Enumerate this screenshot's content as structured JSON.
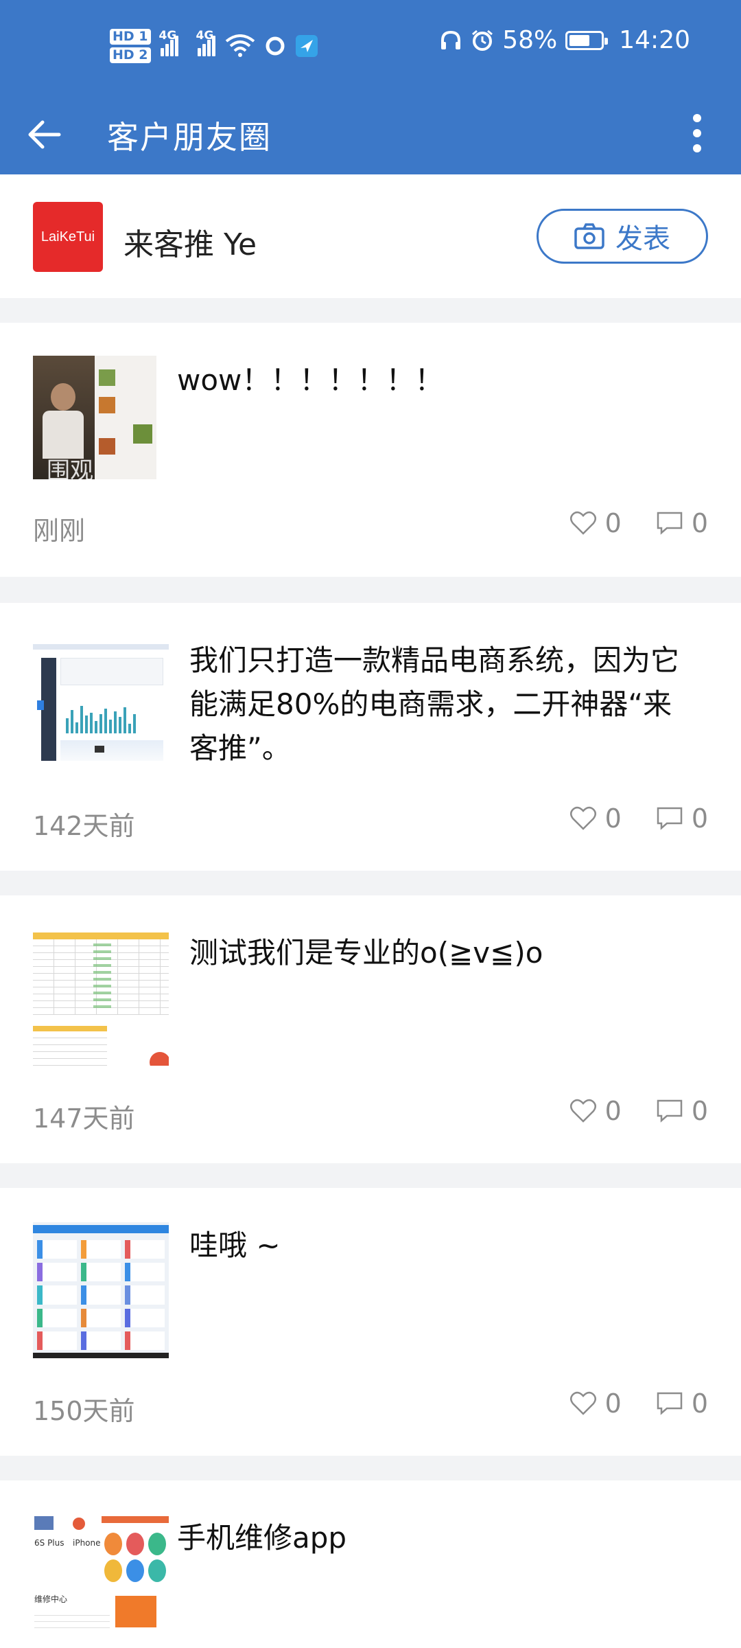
{
  "status": {
    "hd1": "HD 1",
    "hd2": "HD 2",
    "net1": "4G",
    "net2": "4G",
    "battery_percent": "58%",
    "battery_level": 0.58,
    "time": "14:20"
  },
  "appbar": {
    "title": "客户朋友圈"
  },
  "profile": {
    "logo_text": "LaiKeTui",
    "name": "来客推 Ye",
    "post_button": "发表"
  },
  "posts": [
    {
      "text": "wow！！！！！！！",
      "thumb_caption": "围观",
      "time": "刚刚",
      "likes": "0",
      "comments": "0"
    },
    {
      "text": "我们只打造一款精品电商系统，因为它能满足80%的电商需求，二开神器“来客推”。",
      "time": "142天前",
      "likes": "0",
      "comments": "0"
    },
    {
      "text": "测试我们是专业的o(≧v≦)o",
      "time": "147天前",
      "likes": "0",
      "comments": "0"
    },
    {
      "text": "哇哦 ~",
      "time": "150天前",
      "likes": "0",
      "comments": "0"
    },
    {
      "text": "手机维修app",
      "thumb_labels": [
        "6S Plus",
        "iPhone",
        "维修中心"
      ]
    }
  ],
  "colors": {
    "primary": "#3c78c8",
    "logo_red": "#e52a2a",
    "muted": "#8c8c8c"
  }
}
